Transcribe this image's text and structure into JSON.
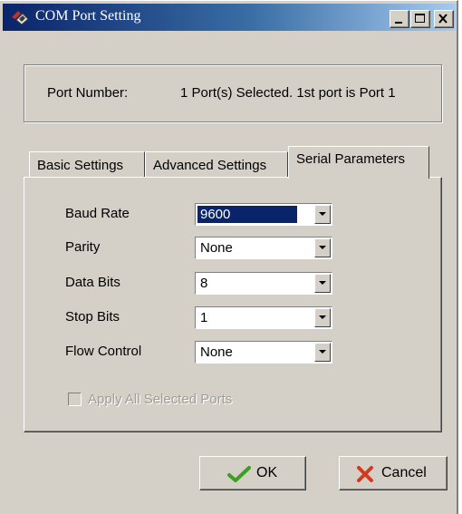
{
  "window": {
    "title": "COM Port Setting"
  },
  "title_buttons": {
    "minimize": "minimize-icon",
    "maximize": "maximize-icon",
    "close": "close-icon"
  },
  "port": {
    "label": "Port Number:",
    "value": "1 Port(s) Selected. 1st port is Port 1"
  },
  "tabs": [
    {
      "label": "Basic Settings",
      "active": false
    },
    {
      "label": "Advanced Settings",
      "active": false
    },
    {
      "label": "Serial Parameters",
      "active": true
    }
  ],
  "serial": {
    "fields": [
      {
        "label": "Baud Rate",
        "value": "9600",
        "selected": true
      },
      {
        "label": "Parity",
        "value": "None"
      },
      {
        "label": "Data Bits",
        "value": "8"
      },
      {
        "label": "Stop Bits",
        "value": "1"
      },
      {
        "label": "Flow Control",
        "value": "None"
      }
    ],
    "apply_all": {
      "label": "Apply All Selected Ports",
      "checked": false,
      "enabled": false
    }
  },
  "buttons": {
    "ok": "OK",
    "cancel": "Cancel"
  },
  "colors": {
    "face": "#d4d0c8",
    "title_start": "#0a246a",
    "title_end": "#a6caf0",
    "selection": "#0a246a",
    "ok_check": "#3aa020",
    "cancel_x": "#d23a20"
  }
}
